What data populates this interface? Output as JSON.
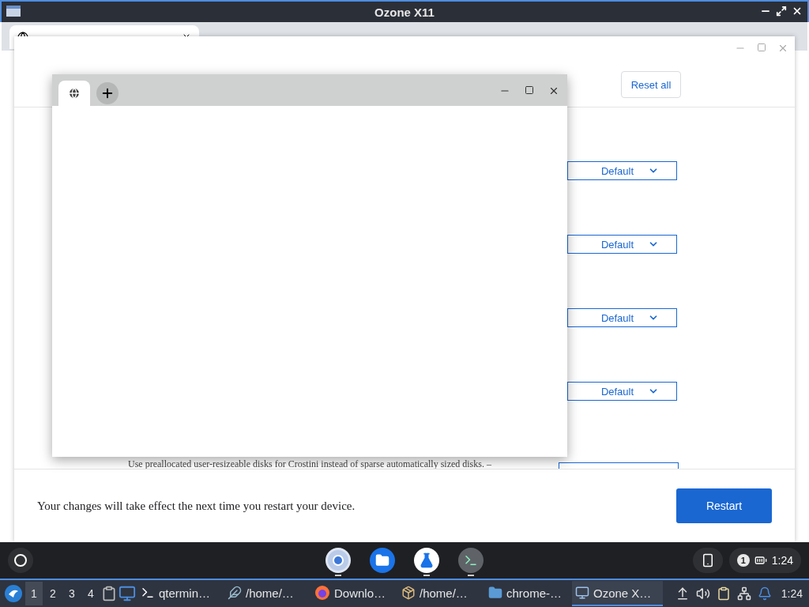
{
  "window": {
    "title": "Ozone X11"
  },
  "flags_dialog": {
    "reset_button": "Reset all",
    "selects": [
      {
        "value": "Default"
      },
      {
        "value": "Default"
      },
      {
        "value": "Default"
      },
      {
        "value": "Default"
      }
    ],
    "partial_flag": {
      "description": "Use preallocated user-resizeable disks for Crostini instead of sparse automatically sized disks. –"
    },
    "footer": {
      "message": "Your changes will take effect the next time you restart your device.",
      "restart_button": "Restart"
    }
  },
  "shelf": {
    "apps": [
      {
        "kind": "browser",
        "running": true
      },
      {
        "kind": "files",
        "running": false
      },
      {
        "kind": "lab",
        "running": true
      },
      {
        "kind": "terminal",
        "running": true
      }
    ],
    "status": {
      "notifications": "1",
      "time": "1:24"
    }
  },
  "taskbar": {
    "workspaces": [
      {
        "label": "1",
        "selected": true
      },
      {
        "label": "2",
        "selected": false
      },
      {
        "label": "3",
        "selected": false
      },
      {
        "label": "4",
        "selected": false
      }
    ],
    "tasks": [
      {
        "kind": "terminal",
        "label": "qtermin…",
        "selected": false
      },
      {
        "kind": "editor",
        "label": "/home/…",
        "selected": false
      },
      {
        "kind": "firefox",
        "label": "Downlo…",
        "selected": false
      },
      {
        "kind": "archive",
        "label": "/home/…",
        "selected": false
      },
      {
        "kind": "folder",
        "label": "chrome-…",
        "selected": false
      },
      {
        "kind": "window",
        "label": "Ozone X…",
        "selected": true
      }
    ],
    "time": "1:24"
  }
}
